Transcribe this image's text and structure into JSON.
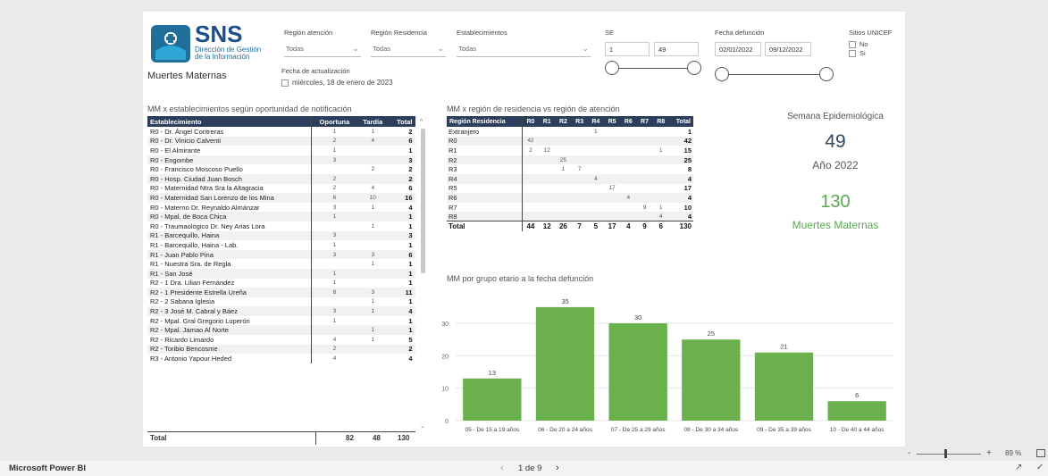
{
  "app": {
    "name": "Microsoft Power BI",
    "zoom": "89 %",
    "page_indicator": "1 de 9"
  },
  "logo": {
    "brand": "SNS",
    "line1": "Dirección de Gestión",
    "line2": "de la Información"
  },
  "report_title": "Muertes Maternas",
  "update": {
    "label": "Fecha de actualización",
    "value": "miércoles, 18 de enero de 2023"
  },
  "filters": {
    "region_atencion": {
      "label": "Región atención",
      "value": "Todas"
    },
    "region_residencia": {
      "label": "Región Residencia",
      "value": "Todas"
    },
    "establecimientos": {
      "label": "Establecimientos",
      "value": "Todas"
    },
    "se": {
      "label": "SE",
      "from": "1",
      "to": "49"
    },
    "fecha": {
      "label": "Fecha defunción",
      "from": "02/01/2022",
      "to": "09/12/2022"
    },
    "unicef": {
      "label": "Sitios UNICEF",
      "opt1": "No",
      "opt2": "Si"
    }
  },
  "table1": {
    "title": "MM x establecimientos según oportunidad de notificación",
    "headers": [
      "Establecimiento",
      "Oportuna",
      "Tardía",
      "Total"
    ],
    "rows": [
      [
        "R0 - Dr. Ángel Contreras",
        "1",
        "1",
        "2"
      ],
      [
        "R0 - Dr. Vinicio Calventi",
        "2",
        "4",
        "6"
      ],
      [
        "R0 - El Almirante",
        "1",
        "",
        "1"
      ],
      [
        "R0 - Engombe",
        "3",
        "",
        "3"
      ],
      [
        "R0 - Francisco Moscoso Puello",
        "",
        "2",
        "2"
      ],
      [
        "R0 - Hosp. Ciudad Juan Bosch",
        "2",
        "",
        "2"
      ],
      [
        "R0 - Maternidad Ntra Sra la Altagracia",
        "2",
        "4",
        "6"
      ],
      [
        "R0 - Maternidad San Lorenzo de los Mina",
        "6",
        "10",
        "16"
      ],
      [
        "R0 - Materno Dr. Reynaldo Almánzar",
        "3",
        "1",
        "4"
      ],
      [
        "R0 - Mpal. de Boca Chica",
        "1",
        "",
        "1"
      ],
      [
        "R0 - Traumaológico Dr. Ney Arias Lora",
        "",
        "1",
        "1"
      ],
      [
        "R1 - Barcequillo, Haina",
        "3",
        "",
        "3"
      ],
      [
        "R1 - Barcequillo, Haina - Lab.",
        "1",
        "",
        "1"
      ],
      [
        "R1 - Juan Pablo Pina",
        "3",
        "3",
        "6"
      ],
      [
        "R1 - Nuestra Sra. de Regla",
        "",
        "1",
        "1"
      ],
      [
        "R1 - San José",
        "1",
        "",
        "1"
      ],
      [
        "R2 - 1 Dra. Lilian Fernández",
        "1",
        "",
        "1"
      ],
      [
        "R2 - 1 Presidente Estrella Ureña",
        "8",
        "3",
        "11"
      ],
      [
        "R2 - 2 Sabana Iglesia",
        "",
        "1",
        "1"
      ],
      [
        "R2 - 3 José M. Cabral y Báez",
        "3",
        "1",
        "4"
      ],
      [
        "R2 - Mpal. Gral Gregorio Luperón",
        "1",
        "",
        "1"
      ],
      [
        "R2 - Mpal. Jamao Al Norte",
        "",
        "1",
        "1"
      ],
      [
        "R2 - Ricardo Limardo",
        "4",
        "1",
        "5"
      ],
      [
        "R2 - Toribio Bencosme",
        "2",
        "",
        "2"
      ],
      [
        "R3 - Antonio Yapour Heded",
        "4",
        "",
        "4"
      ]
    ],
    "total": [
      "Total",
      "82",
      "48",
      "130"
    ]
  },
  "table2": {
    "title": "MM x región de residencia vs región de atención",
    "headers": [
      "Región Residencia",
      "R0",
      "R1",
      "R2",
      "R3",
      "R4",
      "R5",
      "R6",
      "R7",
      "R8",
      "Total"
    ],
    "rows": [
      [
        "Extranjero",
        "",
        "",
        "",
        "",
        "1",
        "",
        "",
        "",
        "",
        "1"
      ],
      [
        "R0",
        "42",
        "",
        "",
        "",
        "",
        "",
        "",
        "",
        "",
        "42"
      ],
      [
        "R1",
        "2",
        "12",
        "",
        "",
        "",
        "",
        "",
        "",
        "1",
        "15"
      ],
      [
        "R2",
        "",
        "",
        "25",
        "",
        "",
        "",
        "",
        "",
        "",
        "25"
      ],
      [
        "R3",
        "",
        "",
        "1",
        "7",
        "",
        "",
        "",
        "",
        "",
        "8"
      ],
      [
        "R4",
        "",
        "",
        "",
        "",
        "4",
        "",
        "",
        "",
        "",
        "4"
      ],
      [
        "R5",
        "",
        "",
        "",
        "",
        "",
        "17",
        "",
        "",
        "",
        "17"
      ],
      [
        "R6",
        "",
        "",
        "",
        "",
        "",
        "",
        "4",
        "",
        "",
        "4"
      ],
      [
        "R7",
        "",
        "",
        "",
        "",
        "",
        "",
        "",
        "9",
        "1",
        "10"
      ],
      [
        "R8",
        "",
        "",
        "",
        "",
        "",
        "",
        "",
        "",
        "4",
        "4"
      ]
    ],
    "total": [
      "Total",
      "44",
      "12",
      "26",
      "7",
      "5",
      "17",
      "4",
      "9",
      "6",
      "130"
    ]
  },
  "kpi": {
    "label_se": "Semana Epidemiológica",
    "se_value": "49",
    "year": "Año 2022",
    "deaths": "130",
    "deaths_label": "Muertes Maternas"
  },
  "colors": {
    "bar": "#6ab04c",
    "header": "#2c3e5c",
    "kpi_green": "#5aa850",
    "kpi_blue": "#34495e"
  },
  "chart_data": {
    "type": "bar",
    "title": "MM por grupo etario a la fecha defunción",
    "categories": [
      "05 - De 15 a 19 años",
      "06 - De 20 a 24 años",
      "07 - De 25 a 29 años",
      "08 - De 30 a 34 años",
      "09 - De 35 a 39 años",
      "10 - De 40 a 44 años"
    ],
    "values": [
      13,
      35,
      30,
      25,
      21,
      6
    ],
    "ylim": [
      0,
      38
    ],
    "yticks": [
      0,
      10,
      20,
      30
    ],
    "grid": true
  }
}
